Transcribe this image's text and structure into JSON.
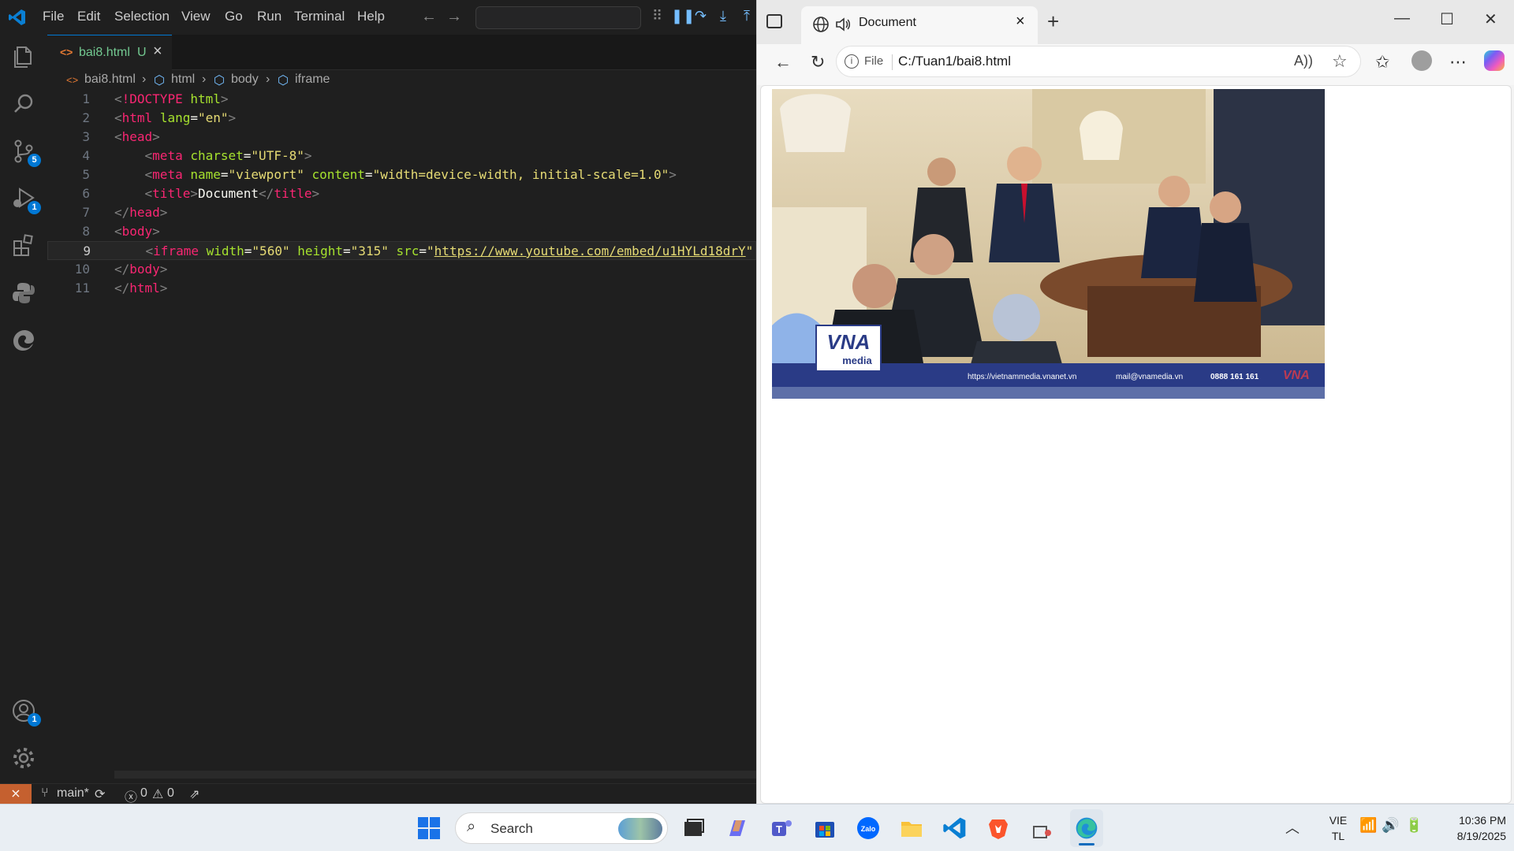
{
  "vscode": {
    "menu": [
      "File",
      "Edit",
      "Selection",
      "View",
      "Go",
      "Run",
      "Terminal",
      "Help"
    ],
    "activity_badges": {
      "source_control": "5",
      "run_debug": "1",
      "accounts": "1"
    },
    "tab": {
      "icon": "<>",
      "title": "bai8.html",
      "status": "U"
    },
    "breadcrumb": [
      "bai8.html",
      "html",
      "body",
      "iframe"
    ],
    "code_lines": [
      {
        "num": "1",
        "tokens": [
          [
            "t-br",
            "<"
          ],
          [
            "t-tag",
            "!DOCTYPE"
          ],
          [
            "t-txt",
            " "
          ],
          [
            "t-attr",
            "html"
          ],
          [
            "t-br",
            ">"
          ]
        ]
      },
      {
        "num": "2",
        "tokens": [
          [
            "t-br",
            "<"
          ],
          [
            "t-tag",
            "html"
          ],
          [
            "t-txt",
            " "
          ],
          [
            "t-attr",
            "lang"
          ],
          [
            "t-txt",
            "="
          ],
          [
            "t-str",
            "\"en\""
          ],
          [
            "t-br",
            ">"
          ]
        ]
      },
      {
        "num": "3",
        "tokens": [
          [
            "t-br",
            "<"
          ],
          [
            "t-tag",
            "head"
          ],
          [
            "t-br",
            ">"
          ]
        ]
      },
      {
        "num": "4",
        "tokens": [
          [
            "t-txt",
            "    "
          ],
          [
            "t-br",
            "<"
          ],
          [
            "t-tag",
            "meta"
          ],
          [
            "t-txt",
            " "
          ],
          [
            "t-attr",
            "charset"
          ],
          [
            "t-txt",
            "="
          ],
          [
            "t-str",
            "\"UTF-8\""
          ],
          [
            "t-br",
            ">"
          ]
        ]
      },
      {
        "num": "5",
        "tokens": [
          [
            "t-txt",
            "    "
          ],
          [
            "t-br",
            "<"
          ],
          [
            "t-tag",
            "meta"
          ],
          [
            "t-txt",
            " "
          ],
          [
            "t-attr",
            "name"
          ],
          [
            "t-txt",
            "="
          ],
          [
            "t-str",
            "\"viewport\""
          ],
          [
            "t-txt",
            " "
          ],
          [
            "t-attr",
            "content"
          ],
          [
            "t-txt",
            "="
          ],
          [
            "t-str",
            "\"width=device-width, initial-scale=1.0\""
          ],
          [
            "t-br",
            ">"
          ]
        ]
      },
      {
        "num": "6",
        "tokens": [
          [
            "t-txt",
            "    "
          ],
          [
            "t-br",
            "<"
          ],
          [
            "t-tag",
            "title"
          ],
          [
            "t-br",
            ">"
          ],
          [
            "t-txt",
            "Document"
          ],
          [
            "t-br",
            "</"
          ],
          [
            "t-tag",
            "title"
          ],
          [
            "t-br",
            ">"
          ]
        ]
      },
      {
        "num": "7",
        "tokens": [
          [
            "t-br",
            "</"
          ],
          [
            "t-tag",
            "head"
          ],
          [
            "t-br",
            ">"
          ]
        ]
      },
      {
        "num": "8",
        "tokens": [
          [
            "t-br",
            "<"
          ],
          [
            "t-tag",
            "body"
          ],
          [
            "t-br",
            ">"
          ]
        ]
      },
      {
        "num": "9",
        "tokens": [
          [
            "t-txt",
            "    "
          ],
          [
            "t-br",
            "<"
          ],
          [
            "t-tag",
            "iframe"
          ],
          [
            "t-txt",
            " "
          ],
          [
            "t-attr",
            "width"
          ],
          [
            "t-txt",
            "="
          ],
          [
            "t-str",
            "\"560\""
          ],
          [
            "t-txt",
            " "
          ],
          [
            "t-attr",
            "height"
          ],
          [
            "t-txt",
            "="
          ],
          [
            "t-str",
            "\"315\""
          ],
          [
            "t-txt",
            " "
          ],
          [
            "t-attr",
            "src"
          ],
          [
            "t-txt",
            "="
          ],
          [
            "t-str",
            "\""
          ],
          [
            "t-url",
            "https://www.youtube.com/embed/u1HYLd18drY"
          ],
          [
            "t-str",
            "\""
          ]
        ]
      },
      {
        "num": "10",
        "tokens": [
          [
            "t-br",
            "</"
          ],
          [
            "t-tag",
            "body"
          ],
          [
            "t-br",
            ">"
          ]
        ]
      },
      {
        "num": "11",
        "tokens": [
          [
            "t-br",
            "</"
          ],
          [
            "t-tag",
            "html"
          ],
          [
            "t-br",
            ">"
          ]
        ]
      }
    ],
    "current_line": "9",
    "status": {
      "branch": "main*",
      "errors": "0",
      "warnings": "0"
    }
  },
  "browser": {
    "tab_title": "Document",
    "address_prefix": "File",
    "address": "C:/Tuan1/bai8.html",
    "video": {
      "logo_main": "VNA",
      "logo_sub": "media",
      "footer_site": "https://vietnammedia.vnanet.vn",
      "footer_email": "mail@vnamedia.vn",
      "footer_phone": "0888 161 161",
      "corner_logo": "VNA"
    }
  },
  "taskbar": {
    "search_label": "Search",
    "lang_top": "VIE",
    "lang_bottom": "TL",
    "time": "10:36 PM",
    "date": "8/19/2025"
  }
}
